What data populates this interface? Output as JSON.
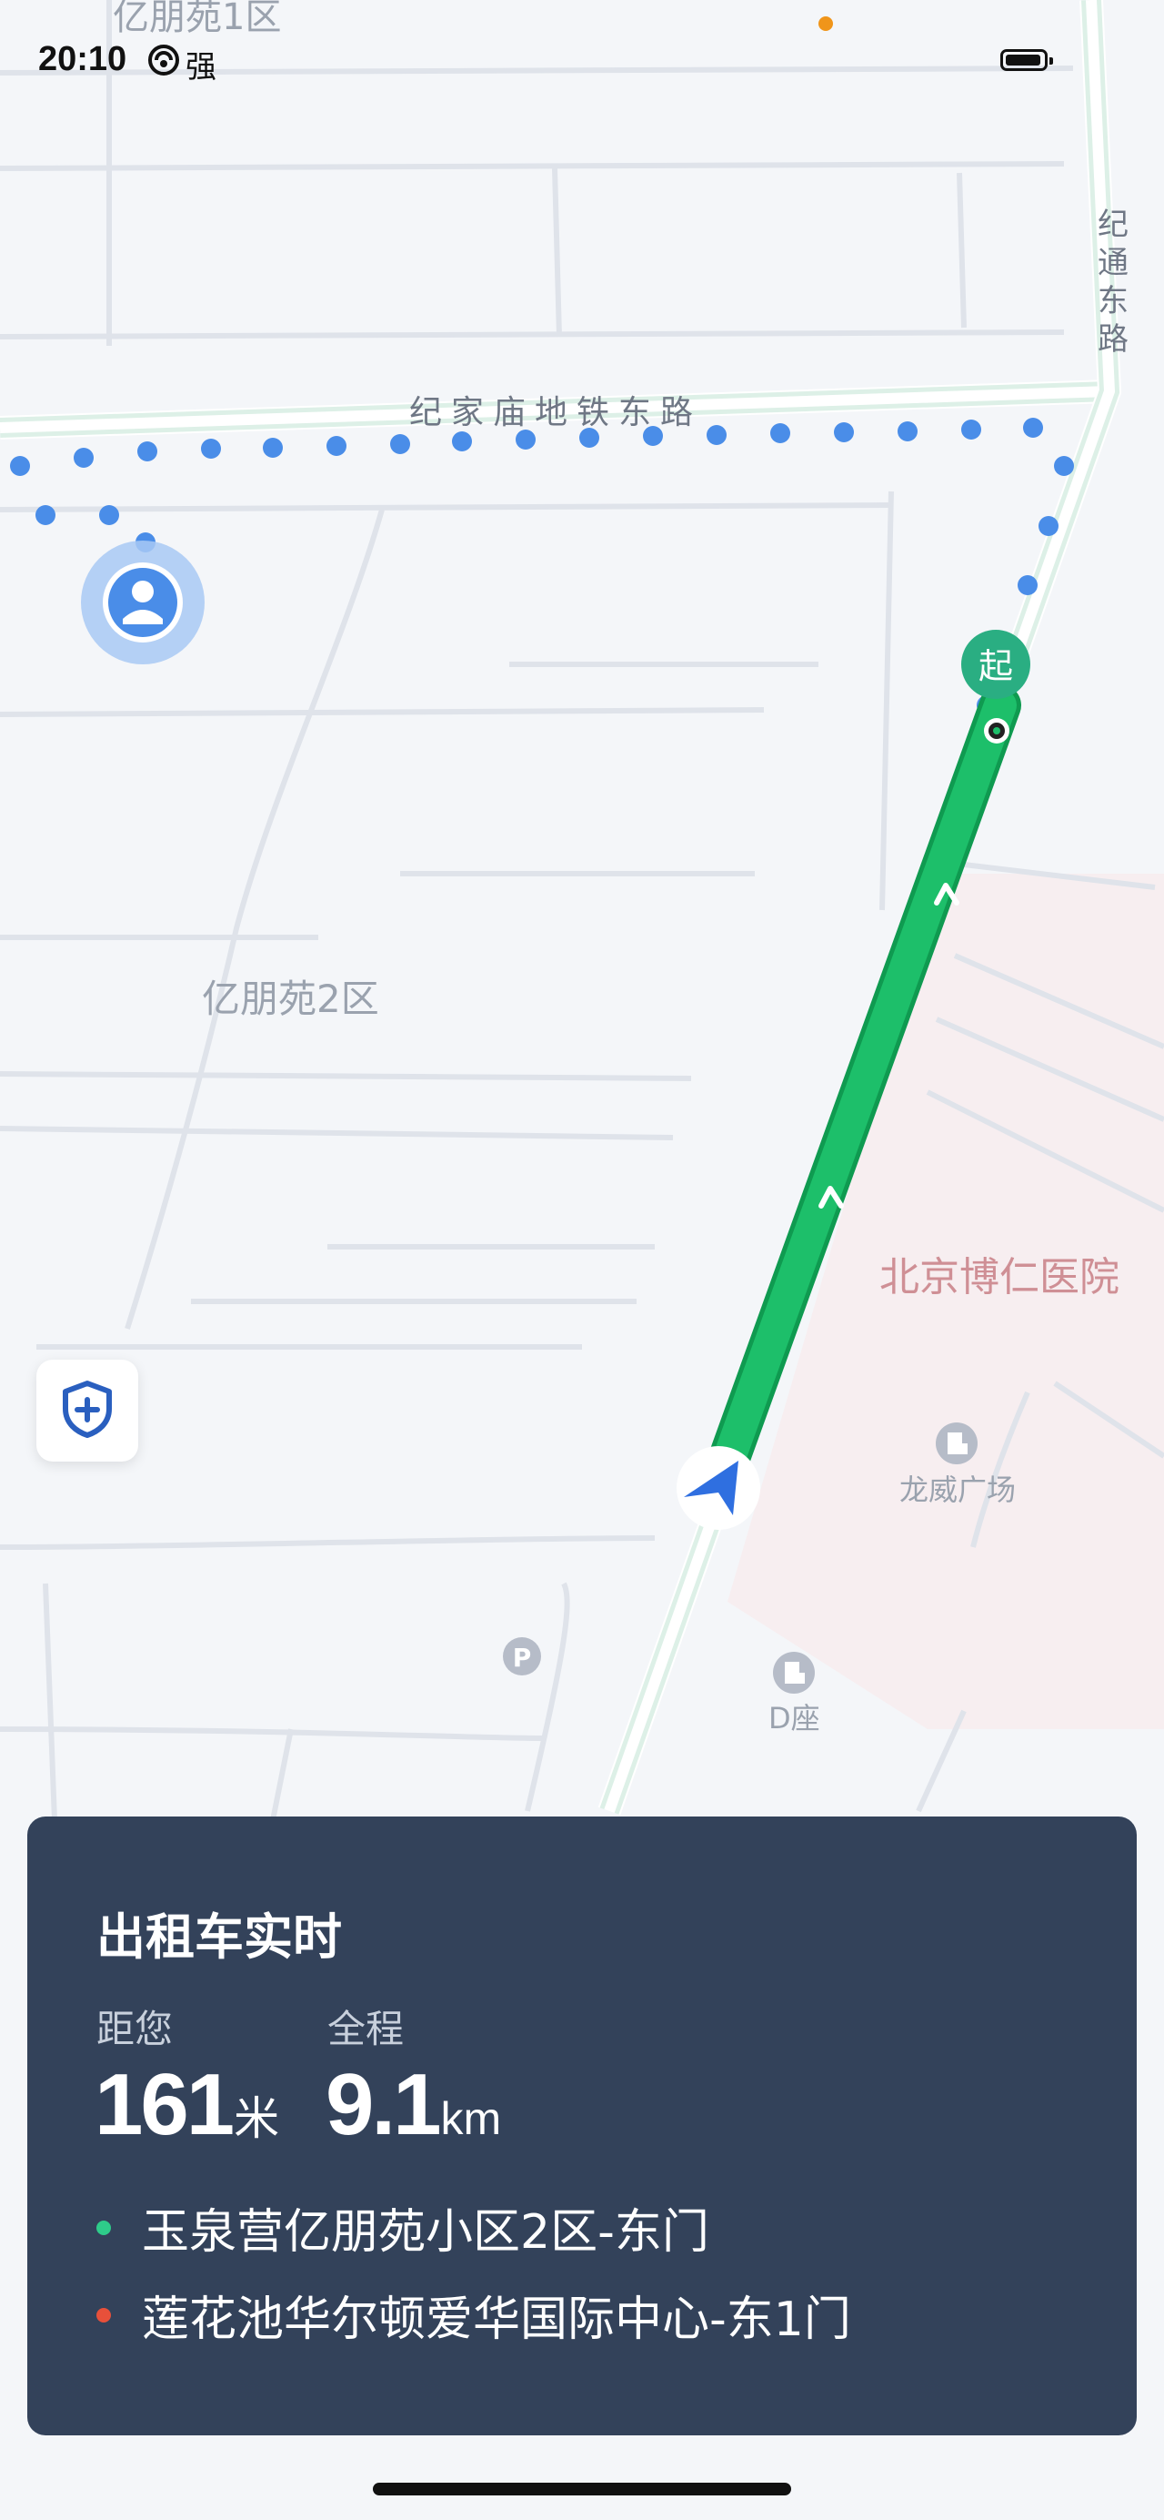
{
  "status_bar": {
    "time": "20:10",
    "signal_label": "强"
  },
  "map": {
    "labels": {
      "area_1": "亿朋苑1区",
      "road_east": "纪家庙地铁东路",
      "road_jitong": "纪通东路",
      "area_2": "亿朋苑2区",
      "hospital": "北京博仁医院",
      "plaza": "龙威广场",
      "building_d": "D座",
      "start_marker": "起"
    },
    "icons": [
      "user-location-icon",
      "car-navigation-icon",
      "parking-icon",
      "building-icon",
      "safety-shield-icon"
    ]
  },
  "card": {
    "title": "出租车实时",
    "distance_label": "距您",
    "distance_value": "161",
    "distance_unit": "米",
    "total_label": "全程",
    "total_value": "9.1",
    "total_unit": "km",
    "origin": "玉泉营亿朋苑小区2区-东门",
    "destination": "莲花池华尔顿爱华国际中心-东1门",
    "colors": {
      "origin_dot": "#2ecc8a",
      "destination_dot": "#e8503a",
      "route": "#1dbf6a"
    }
  }
}
